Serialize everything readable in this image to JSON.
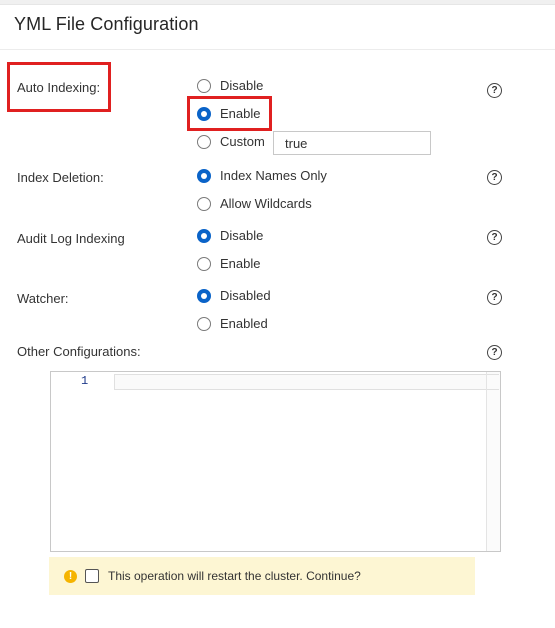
{
  "header": {
    "title": "YML File Configuration"
  },
  "auto_indexing": {
    "label": "Auto Indexing:",
    "options": [
      {
        "label": "Disable",
        "selected": false
      },
      {
        "label": "Enable",
        "selected": true
      },
      {
        "label": "Custom",
        "selected": false
      }
    ],
    "custom_value": "true"
  },
  "index_deletion": {
    "label": "Index Deletion:",
    "options": [
      {
        "label": "Index Names Only",
        "selected": true
      },
      {
        "label": "Allow Wildcards",
        "selected": false
      }
    ]
  },
  "audit_log_indexing": {
    "label": "Audit Log Indexing",
    "options": [
      {
        "label": "Disable",
        "selected": true
      },
      {
        "label": "Enable",
        "selected": false
      }
    ]
  },
  "watcher": {
    "label": "Watcher:",
    "options": [
      {
        "label": "Disabled",
        "selected": true
      },
      {
        "label": "Enabled",
        "selected": false
      }
    ]
  },
  "other_configurations": {
    "label": "Other Configurations:",
    "line_number": "1"
  },
  "help_glyph": "?",
  "warning": {
    "icon_glyph": "!",
    "text": "This operation will restart the cluster. Continue?"
  },
  "colors": {
    "accent": "#0a63c8",
    "highlight": "#e02020",
    "warning_bg": "#fdf6d3",
    "warning_icon": "#f5b400"
  }
}
